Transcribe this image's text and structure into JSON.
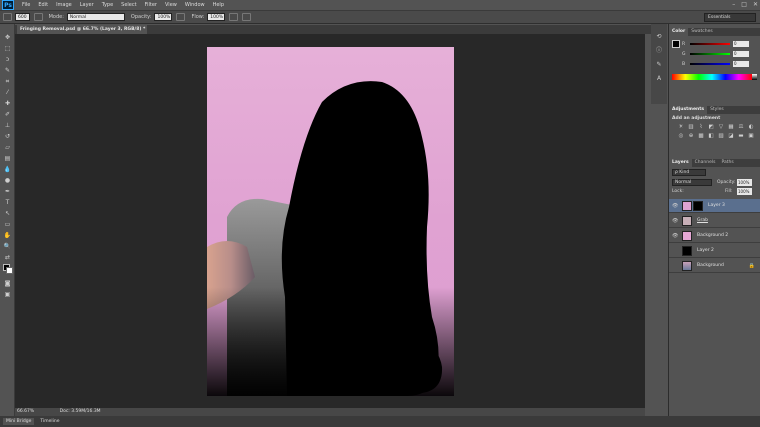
{
  "app": {
    "logo": "Ps"
  },
  "menu": [
    "File",
    "Edit",
    "Image",
    "Layer",
    "Type",
    "Select",
    "Filter",
    "View",
    "Window",
    "Help"
  ],
  "window_controls": [
    "–",
    "□",
    "✕"
  ],
  "options": {
    "brush_size": "600",
    "mode_label": "Mode:",
    "mode_value": "Normal",
    "opacity_label": "Opacity:",
    "opacity_value": "100%",
    "flow_label": "Flow:",
    "flow_value": "100%",
    "workspace": "Essentials"
  },
  "document": {
    "tab_title": "Fringing Removal.psd @ 66.7% (Layer 3, RGB/8) *",
    "close_glyph": "×"
  },
  "status": {
    "zoom": "66.67%",
    "doc": "Doc: 3.59M/16.3M"
  },
  "bottom_tabs": [
    "Mini Bridge",
    "Timeline"
  ],
  "color_panel": {
    "tabs": [
      "Color",
      "Swatches"
    ],
    "channels": [
      {
        "label": "R",
        "value": "0"
      },
      {
        "label": "G",
        "value": "0"
      },
      {
        "label": "B",
        "value": "0"
      }
    ]
  },
  "adjustments_panel": {
    "tabs": [
      "Adjustments",
      "Styles"
    ],
    "heading": "Add an adjustment"
  },
  "layers_panel": {
    "tabs": [
      "Layers",
      "Channels",
      "Paths"
    ],
    "filter_kind": "ρ Kind",
    "blend_mode": "Normal",
    "opacity_label": "Opacity:",
    "opacity_value": "100%",
    "lock_label": "Lock:",
    "fill_label": "Fill:",
    "fill_value": "100%",
    "layers": [
      {
        "name": "Layer 3",
        "selected": true,
        "visible": true
      },
      {
        "name": "Grab",
        "selected": false,
        "visible": true
      },
      {
        "name": "Background 2",
        "selected": false,
        "visible": true
      },
      {
        "name": "Layer 2",
        "selected": false,
        "visible": false
      },
      {
        "name": "Background",
        "selected": false,
        "visible": false,
        "locked": true
      }
    ]
  },
  "colors": {
    "canvas_bg": "#282828",
    "doc_pink": "#e0a2d2",
    "selected_layer": "#5a6f8e",
    "silhouette": "#000000"
  }
}
